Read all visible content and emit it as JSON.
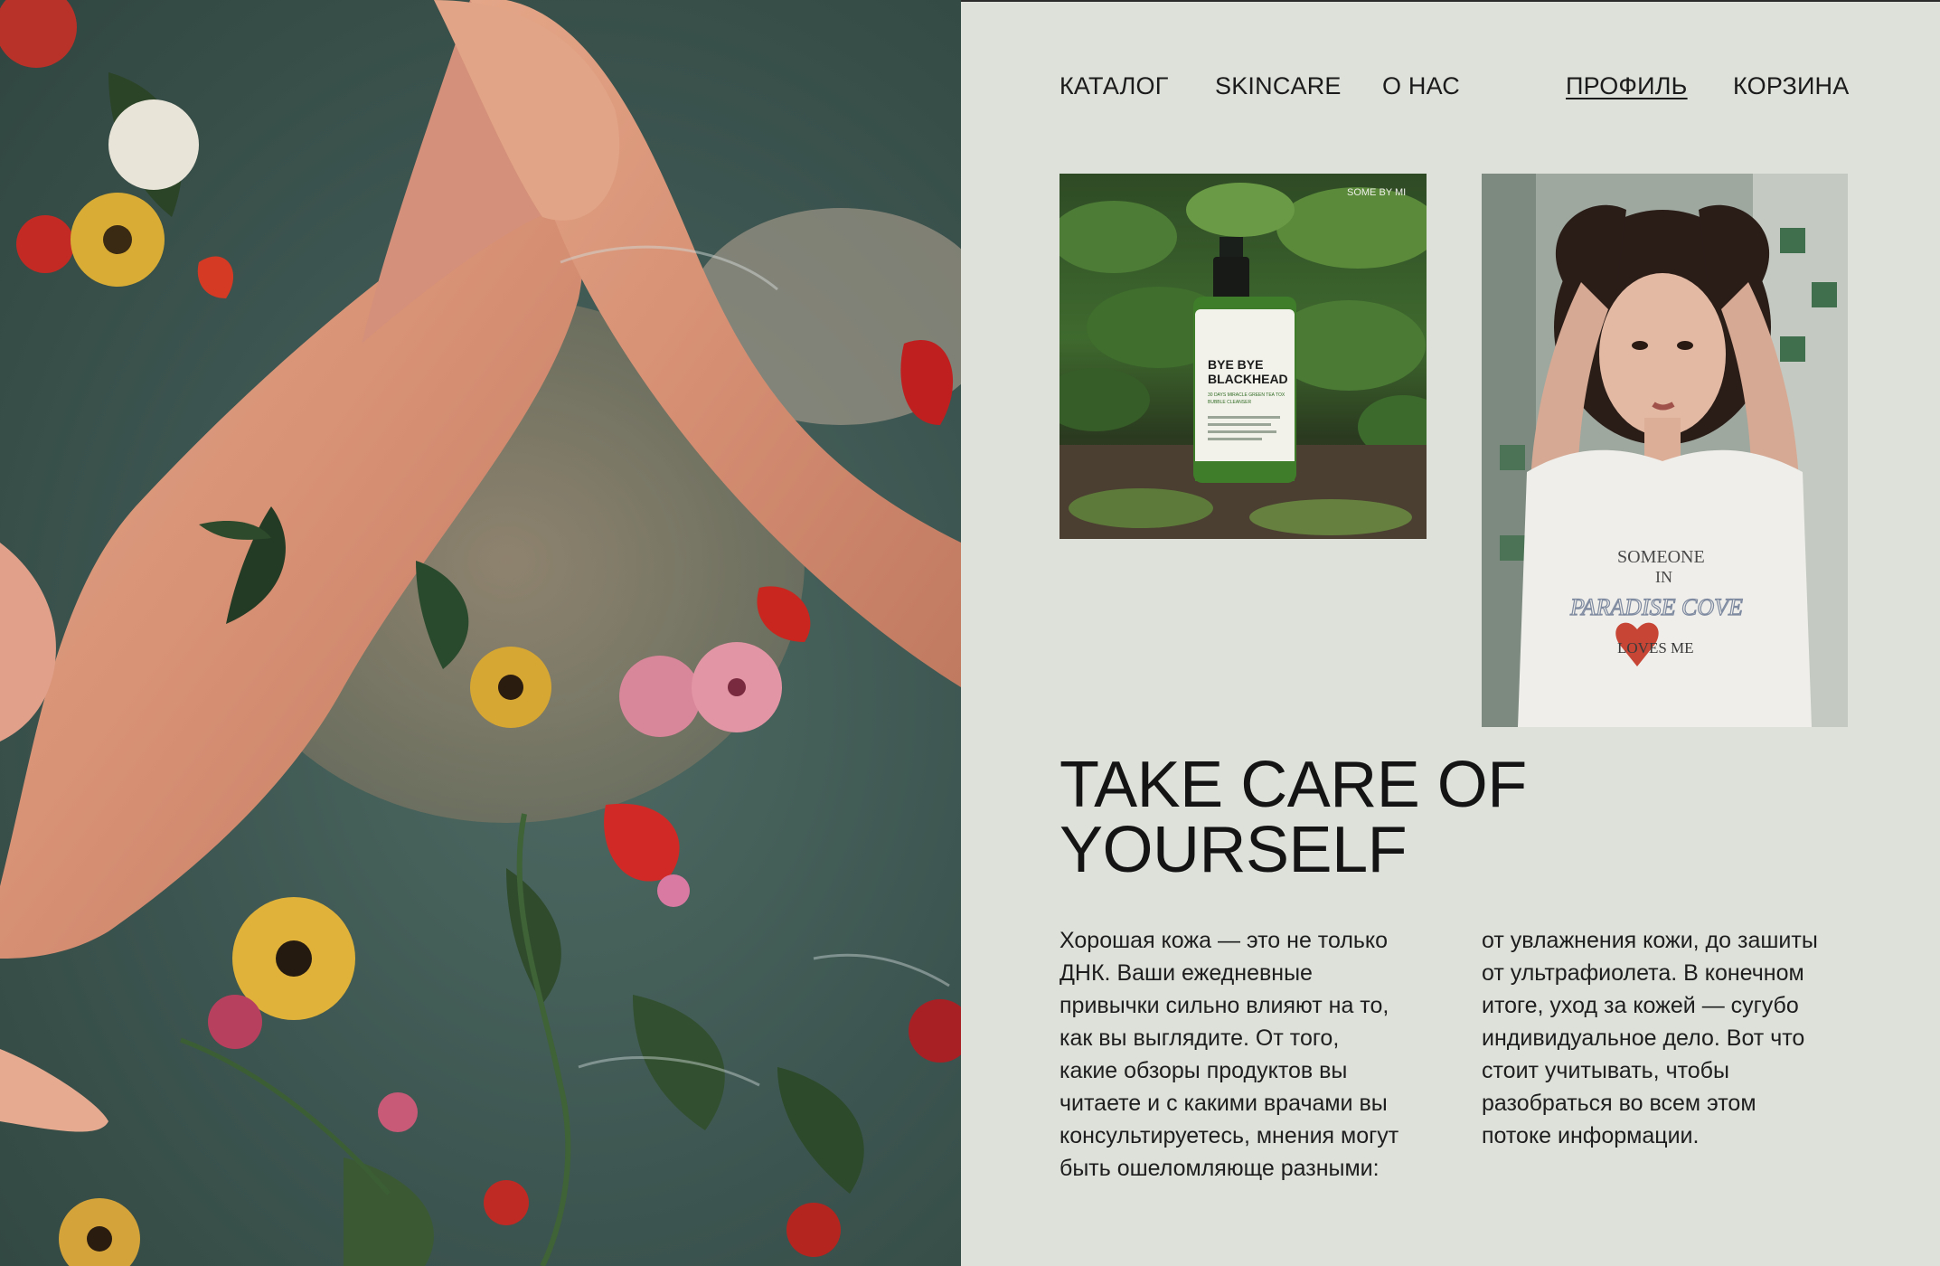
{
  "nav": {
    "left_items": [
      {
        "label": "КАТАЛОГ"
      },
      {
        "label": "SKINCARE"
      },
      {
        "label": "О НАС"
      }
    ],
    "profile_label": "ПРОФИЛЬ",
    "cart_label": "КОРЗИНА"
  },
  "product_image": {
    "brand_mark": "SOME BY MI",
    "bottle_line1": "BYE BYE",
    "bottle_line2": "BLACKHEAD",
    "bottle_sub1": "30 DAYS MIRACLE GREEN TEA TOX",
    "bottle_sub2": "BUBBLE CLEANSER"
  },
  "model_image": {
    "shirt_line1": "SOMEONE",
    "shirt_line2": "IN",
    "shirt_line3": "PARADISE COVE",
    "shirt_line4": "LOVES ME"
  },
  "headline": {
    "line1": "TAKE CARE OF",
    "line2": "YOURSELF"
  },
  "body": {
    "left_lines": [
      "Хорошая кожа — это не только",
      "ДНК. Ваши ежедневные",
      "привычки сильно влияют на то,",
      "как вы выглядите. От того,",
      "какие обзоры продуктов вы",
      "читаете и с какими врачами вы",
      "консультируетесь, мнения могут",
      "быть ошеломляюще разными:"
    ],
    "right_lines": [
      "от увлажнения кожи, до зашиты",
      "от ультрафиолета. В конечном",
      "итоге, уход за кожей — сугубо",
      "индивидуальное дело. Вот что",
      "стоит учитывать, чтобы",
      "разобраться во всем этом",
      "потоке информации."
    ]
  },
  "colors": {
    "background": "#dde1da",
    "text": "#1b1b1b",
    "water": "#3c544f",
    "skin": "#d9967a"
  }
}
